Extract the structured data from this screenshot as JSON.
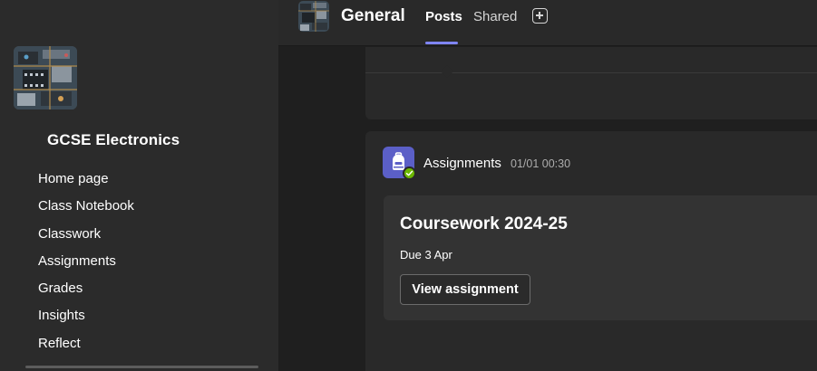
{
  "sidebar": {
    "team_name": "GCSE Electronics",
    "items": [
      {
        "label": "Home page"
      },
      {
        "label": "Class Notebook"
      },
      {
        "label": "Classwork"
      },
      {
        "label": "Assignments"
      },
      {
        "label": "Grades"
      },
      {
        "label": "Insights"
      },
      {
        "label": "Reflect"
      }
    ]
  },
  "header": {
    "channel_name": "General",
    "tabs": [
      {
        "label": "Posts",
        "active": true
      },
      {
        "label": "Shared",
        "active": false
      }
    ],
    "add_tab_icon": "add-square-icon"
  },
  "post": {
    "author": "Assignments",
    "timestamp": "01/01 00:30",
    "app_icon": "assignments-backpack-icon",
    "status": "available",
    "card": {
      "title": "Coursework 2024-25",
      "due": "Due 3 Apr",
      "button_label": "View assignment"
    }
  },
  "colors": {
    "accent": "#7f85f5",
    "app_icon_bg": "#5b5fc7",
    "status_green": "#6bb700",
    "sidebar_bg": "#2b2b2b",
    "main_bg": "#1f1f1f"
  }
}
